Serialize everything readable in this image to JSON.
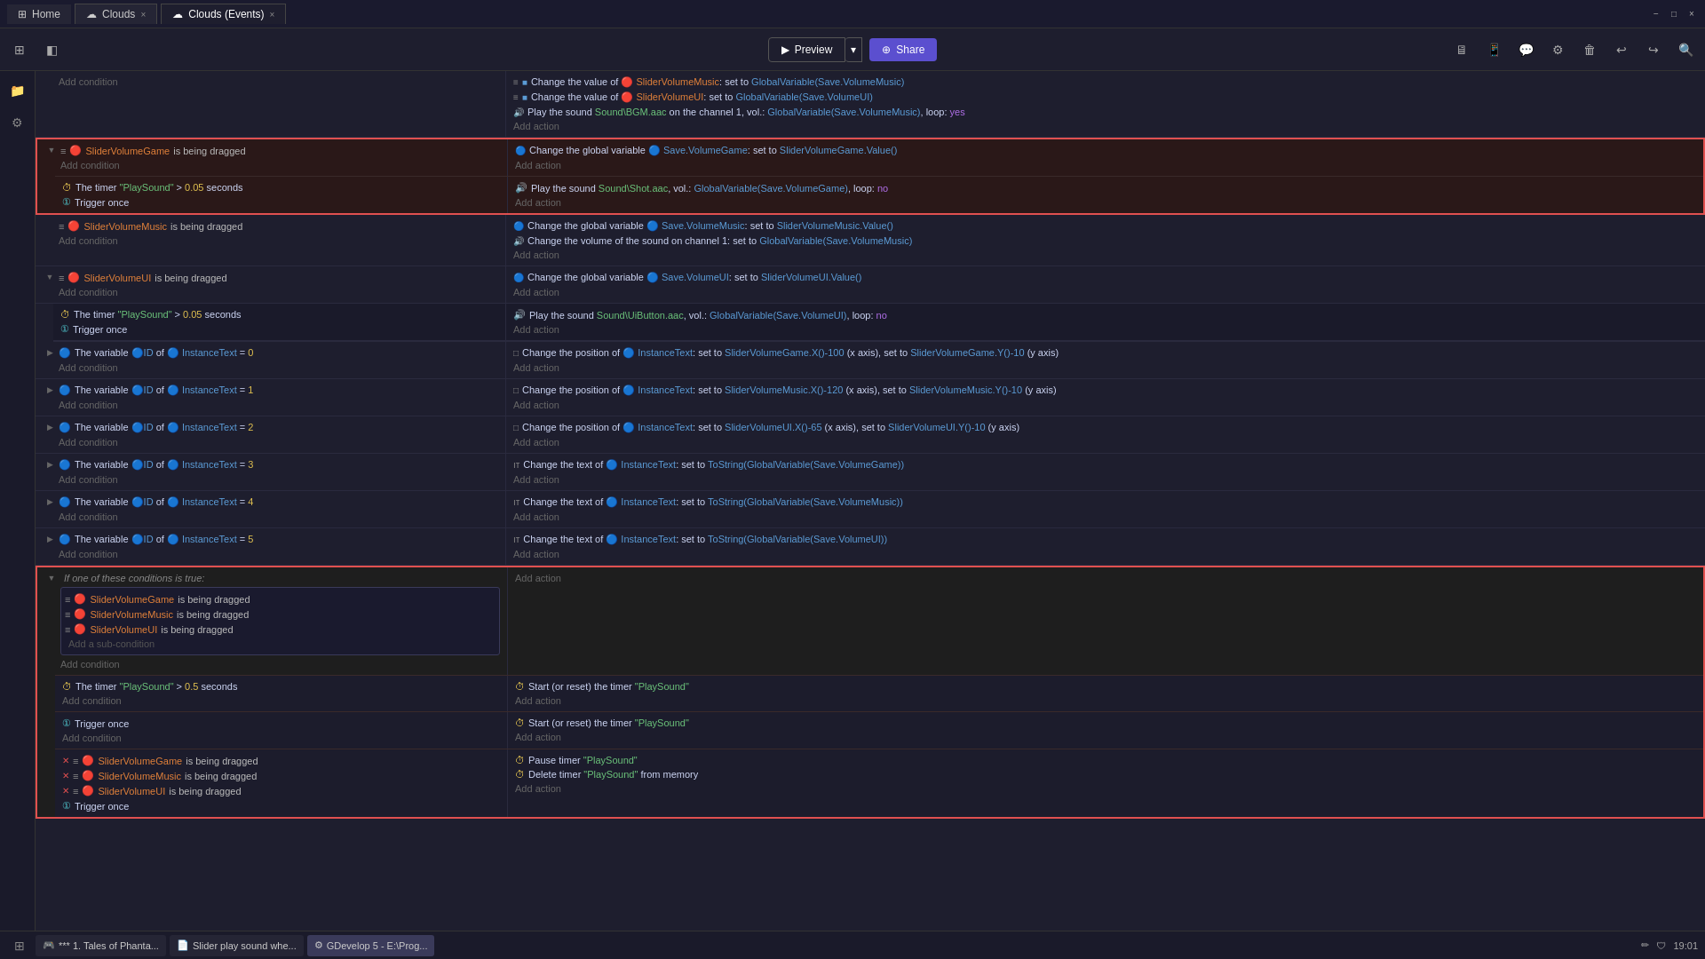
{
  "window": {
    "title": "GDevelop",
    "min_label": "−",
    "max_label": "□",
    "close_label": "×"
  },
  "tabs": [
    {
      "id": "home",
      "label": "Home",
      "closable": false,
      "active": false
    },
    {
      "id": "clouds",
      "label": "Clouds",
      "closable": true,
      "active": false
    },
    {
      "id": "clouds-events",
      "label": "Clouds (Events)",
      "closable": true,
      "active": true
    }
  ],
  "toolbar": {
    "preview_label": "Preview",
    "share_label": "Share"
  },
  "events": [
    {
      "id": "e1",
      "conditions": [
        "Add condition"
      ],
      "actions": [
        "≡ Change the value of 🔴 SliderVolumeMusic: set to GlobalVariable(Save.VolumeMusic)",
        "≡ Change the value of 🔴 SliderVolumeUI: set to GlobalVariable(Save.VolumeUI)",
        "🔊 Play the sound Sound\\BGM.aac on the channel 1, vol.: GlobalVariable(Save.VolumeMusic), loop: yes",
        "Add action"
      ]
    },
    {
      "id": "e2",
      "selected": true,
      "conditions": [
        "≡ 🔴 SliderVolumeGame is being dragged",
        "Add condition"
      ],
      "actions": [
        "🔵 Change the global variable 🔵 Save.VolumeGame: set to SliderVolumeGame.Value()",
        "Add action"
      ],
      "sub_events": [
        {
          "id": "e2s1",
          "conditions": [
            "⏱ The timer \"PlaySound\" > 0.05 seconds",
            "① Trigger once"
          ],
          "actions": [
            "🔊 Play the sound Sound\\Shot.aac, vol.: GlobalVariable(Save.VolumeGame), loop: no",
            "Add action"
          ]
        }
      ]
    },
    {
      "id": "e3",
      "conditions": [
        "≡ 🔴 SliderVolumeMusic is being dragged",
        "Add condition"
      ],
      "actions": [
        "🔵 Change the global variable 🔵 Save.VolumeMusic: set to SliderVolumeMusic.Value()",
        "🔊 Change the volume of the sound on channel 1: set to GlobalVariable(Save.VolumeMusic)",
        "Add action"
      ]
    },
    {
      "id": "e4",
      "conditions": [
        "≡ 🔴 SliderVolumeUI is being dragged",
        "Add condition"
      ],
      "actions": [
        "🔵 Change the global variable 🔵 Save.VolumeUI: set to SliderVolumeUI.Value()",
        "Add action"
      ],
      "sub_events": [
        {
          "id": "e4s1",
          "conditions": [
            "⏱ The timer \"PlaySound\" > 0.05 seconds",
            "① Trigger once"
          ],
          "actions": [
            "🔊 Play the sound Sound\\UiButton.aac, vol.: GlobalVariable(Save.VolumeUI), loop: no",
            "Add action"
          ]
        }
      ]
    },
    {
      "id": "e5",
      "conditions": [
        "🔵 The variable 🔵ID of 🔵 InstanceText = 0",
        "Add condition"
      ],
      "actions": [
        "□ Change the position of 🔵 InstanceText: set to SliderVolumeGame.X()-100 (x axis), set to SliderVolumeGame.Y()-10 (y axis)",
        "Add action"
      ]
    },
    {
      "id": "e6",
      "conditions": [
        "🔵 The variable 🔵ID of 🔵 InstanceText = 1",
        "Add condition"
      ],
      "actions": [
        "□ Change the position of 🔵 InstanceText: set to SliderVolumeMusic.X()-120 (x axis), set to SliderVolumeMusic.Y()-10 (y axis)",
        "Add action"
      ]
    },
    {
      "id": "e7",
      "conditions": [
        "🔵 The variable 🔵ID of 🔵 InstanceText = 2",
        "Add condition"
      ],
      "actions": [
        "□ Change the position of 🔵 InstanceText: set to SliderVolumeUI.X()-65 (x axis), set to SliderVolumeUI.Y()-10 (y axis)",
        "Add action"
      ]
    },
    {
      "id": "e8",
      "conditions": [
        "🔵 The variable 🔵ID of 🔵 InstanceText = 3",
        "Add condition"
      ],
      "actions": [
        "ıт Change the text of 🔵 InstanceText: set to ToString(GlobalVariable(Save.VolumeGame))",
        "Add action"
      ]
    },
    {
      "id": "e9",
      "conditions": [
        "🔵 The variable 🔵ID of 🔵 InstanceText = 4",
        "Add condition"
      ],
      "actions": [
        "ıт Change the text of 🔵 InstanceText: set to ToString(GlobalVariable(Save.VolumeMusic))",
        "Add action"
      ]
    },
    {
      "id": "e10",
      "conditions": [
        "🔵 The variable 🔵ID of 🔵 InstanceText = 5",
        "Add condition"
      ],
      "actions": [
        "ıт Change the text of 🔵 InstanceText: set to ToString(GlobalVariable(Save.VolumeUI))",
        "Add action"
      ]
    },
    {
      "id": "e11",
      "selected": true,
      "or_block": true,
      "conditions": [
        "If one of these conditions is true:",
        "≡ 🔴 SliderVolumeGame is being dragged",
        "≡ 🔴 SliderVolumeMusic is being dragged",
        "≡ 🔴 SliderVolumeUI is being dragged",
        "Add a sub-condition",
        "Add condition"
      ],
      "actions": [
        "Add action"
      ],
      "sub_events": [
        {
          "id": "e11s1",
          "conditions": [
            "⏱ The timer \"PlaySound\" > 0.5 seconds",
            "Add condition"
          ],
          "actions": [
            "⏱ Start (or reset) the timer \"PlaySound\"",
            "Add action"
          ]
        },
        {
          "id": "e11s2",
          "conditions": [
            "① Trigger once",
            "Add condition"
          ],
          "actions": [
            "⏱ Start (or reset) the timer \"PlaySound\"",
            "Add action"
          ]
        },
        {
          "id": "e11s3",
          "conditions": [
            "❌ ≡ 🔴 SliderVolumeGame is being dragged",
            "❌ ≡ 🔴 SliderVolumeMusic is being dragged",
            "❌ ≡ 🔴 SliderVolumeUI is being dragged",
            "① Trigger once"
          ],
          "actions": [
            "⏱ Pause timer \"PlaySound\"",
            "⏱ Delete timer \"PlaySound\" from memory",
            "Add action"
          ]
        }
      ]
    }
  ],
  "taskbar": {
    "start_label": "⊞",
    "items": [
      {
        "label": "*** 1. Tales of Phanta...",
        "active": false,
        "icon": "🎮"
      },
      {
        "label": "Slider play sound whe...",
        "active": false,
        "icon": "📄"
      },
      {
        "label": "GDevelop 5 - E:\\Prog...",
        "active": true,
        "icon": "⚙"
      }
    ],
    "time": "19:01",
    "right_icons": [
      "🔧",
      "🛡"
    ]
  }
}
